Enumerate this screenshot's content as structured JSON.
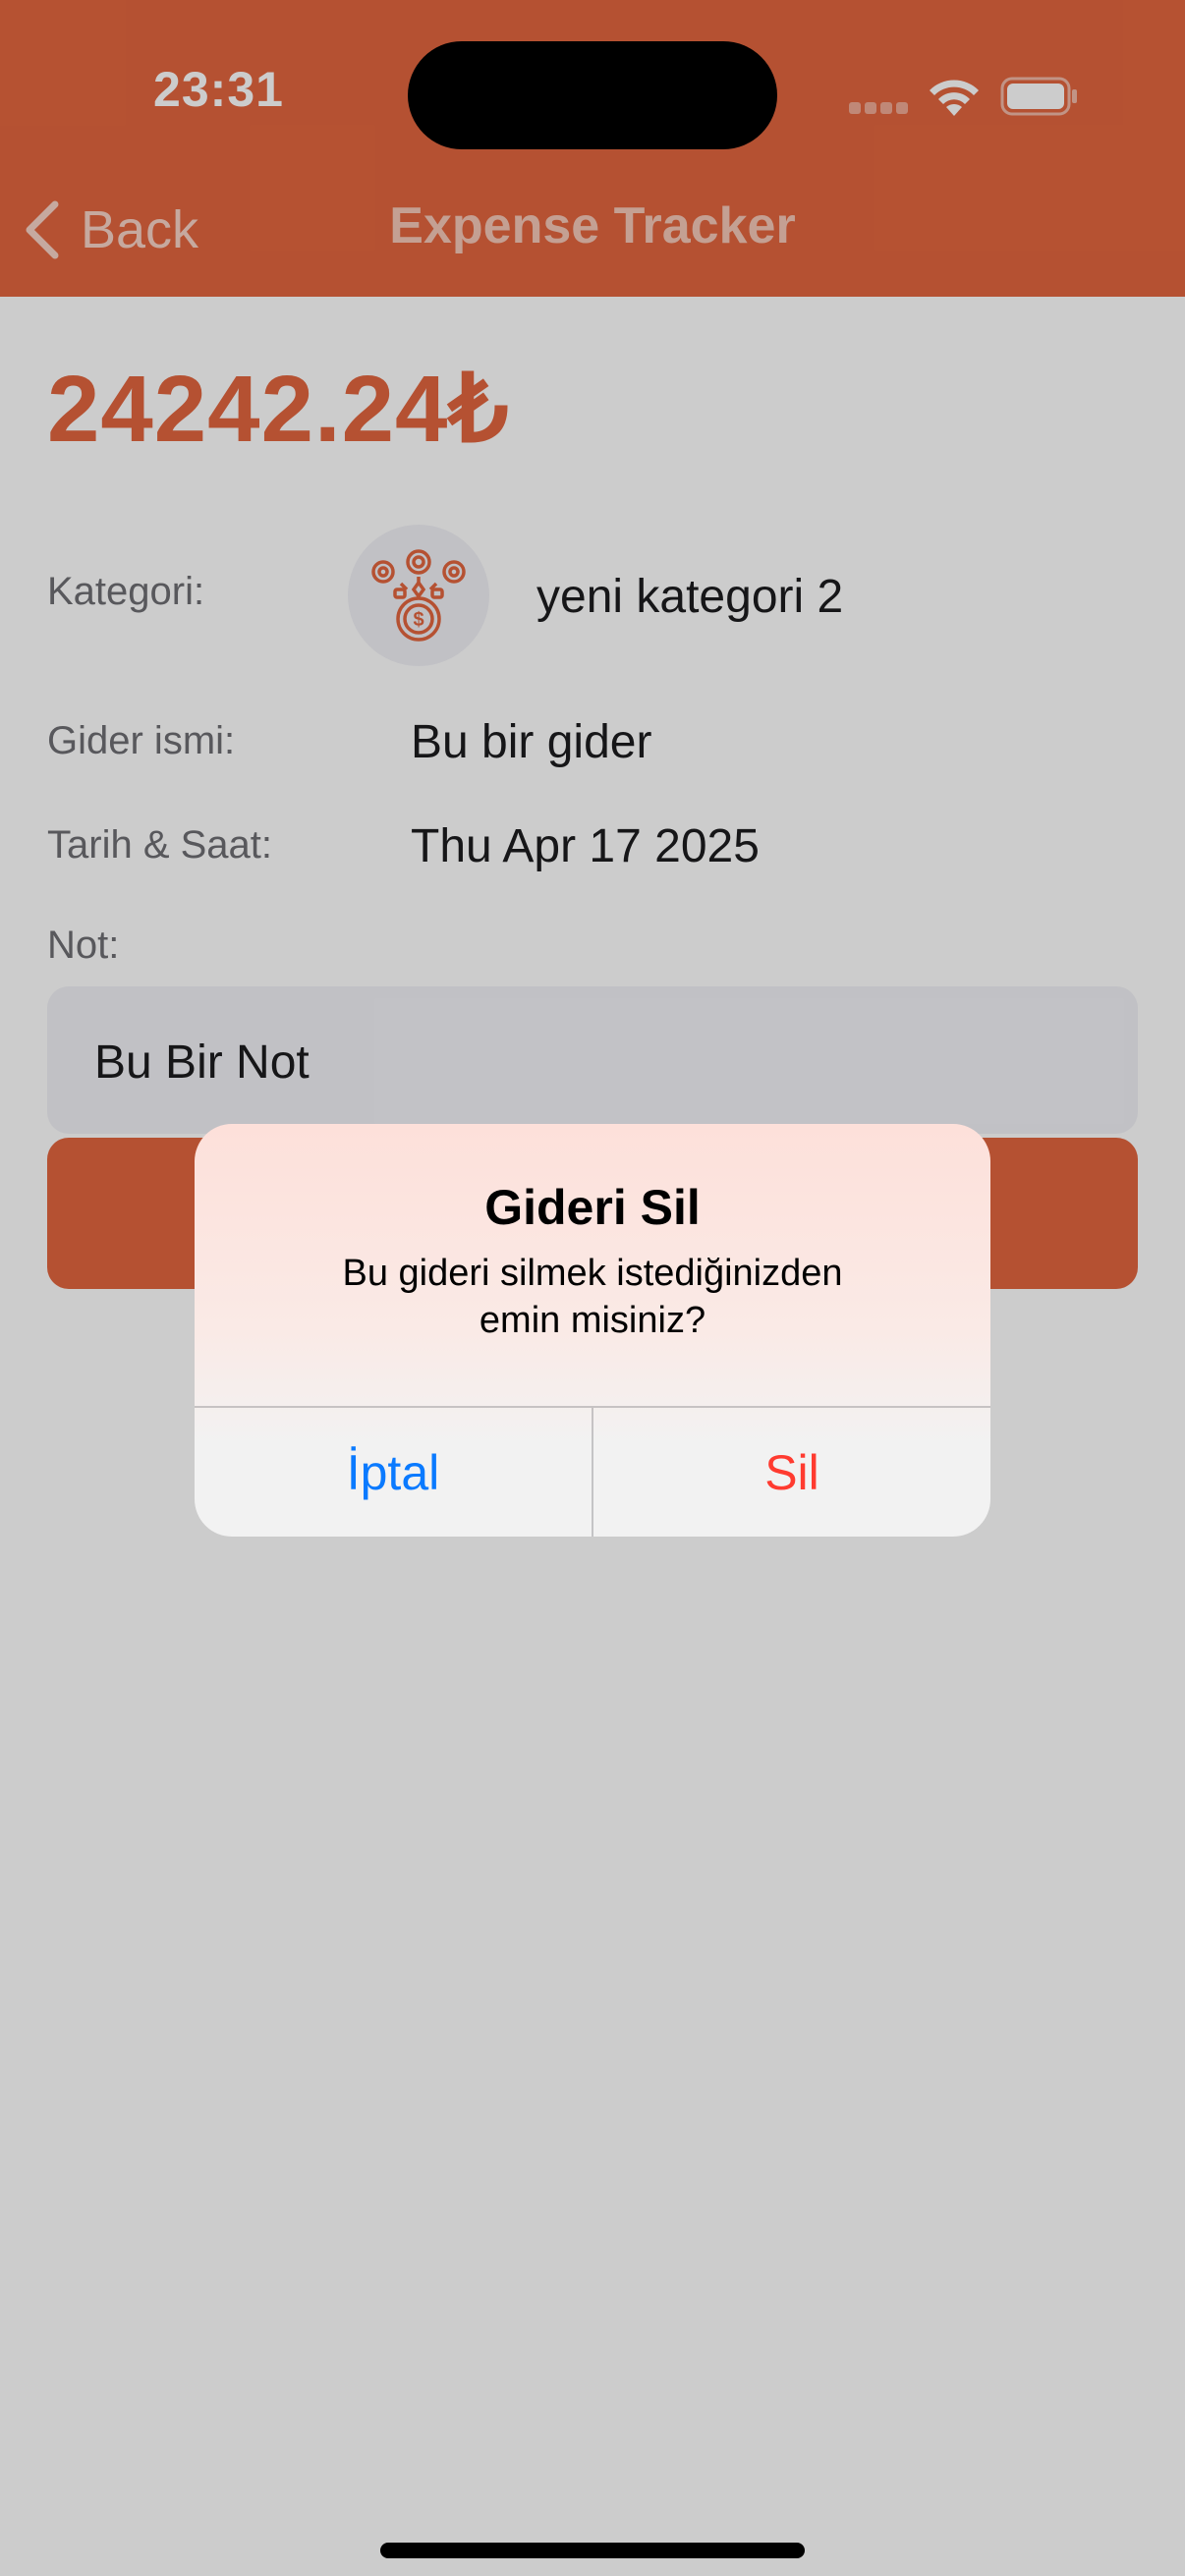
{
  "status_bar": {
    "time": "23:31"
  },
  "nav": {
    "back_label": "Back",
    "title": "Expense Tracker"
  },
  "expense": {
    "amount": "24242.24₺",
    "category_label": "Kategori:",
    "category_value": "yeni kategori 2",
    "name_label": "Gider ismi:",
    "name_value": "Bu bir gider",
    "date_label": "Tarih & Saat:",
    "date_value": "Thu Apr 17 2025",
    "note_label": "Not:",
    "note_value": "Bu Bir Not"
  },
  "alert": {
    "title": "Gideri Sil",
    "message": "Bu gideri silmek istediğinizden emin misiniz?",
    "cancel_label": "İptal",
    "confirm_label": "Sil"
  },
  "colors": {
    "accent": "#e3663f",
    "cancel": "#0a7aff",
    "destructive": "#ff3b30"
  },
  "icons": {
    "back": "chevron-left-icon",
    "category": "coins-money-icon",
    "wifi": "wifi-icon",
    "battery": "battery-icon"
  }
}
